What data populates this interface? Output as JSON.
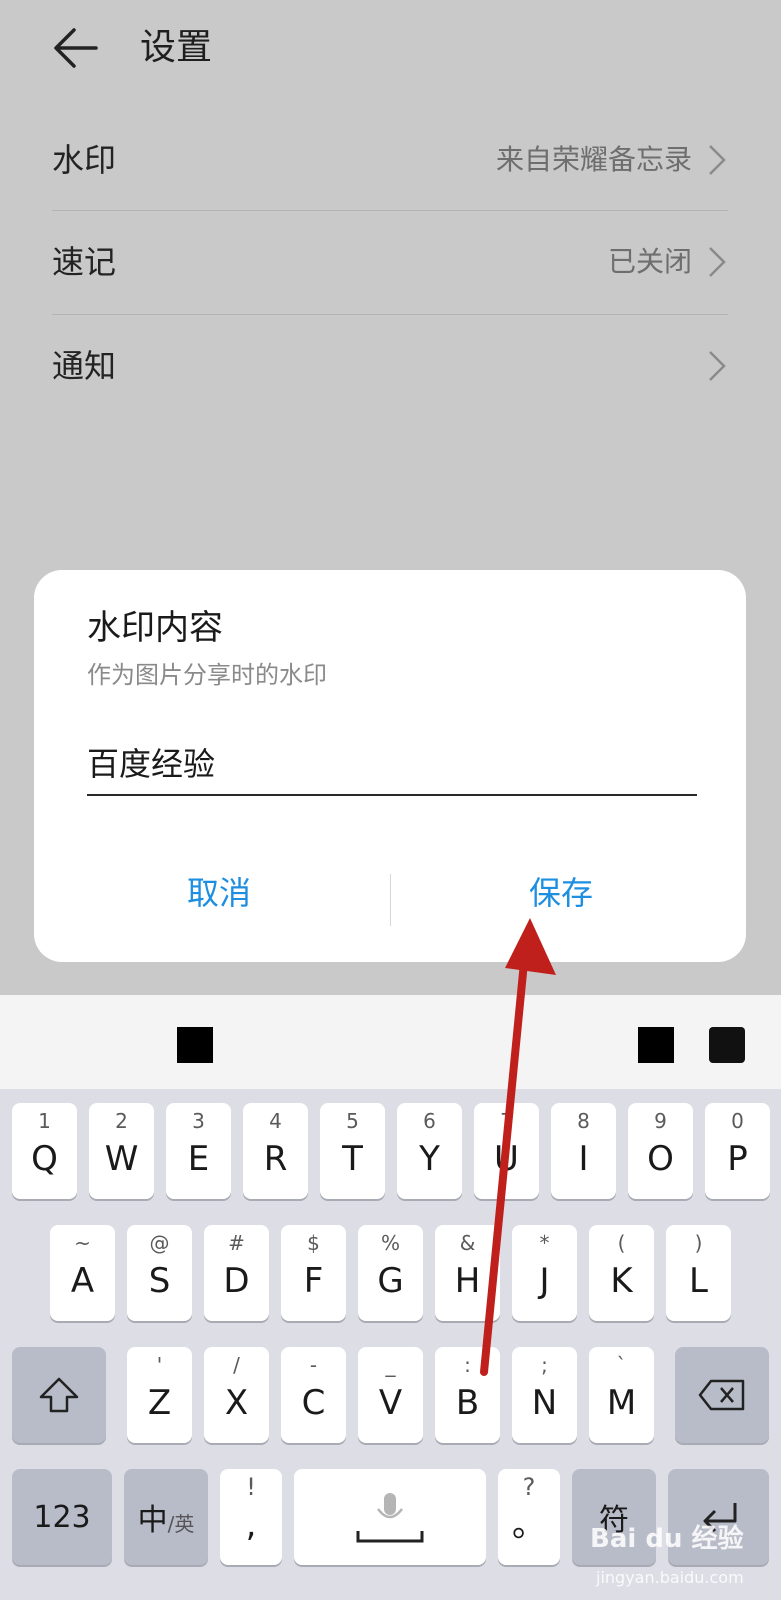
{
  "header": {
    "title": "设置"
  },
  "settings": [
    {
      "label": "水印",
      "value": "来自荣耀备忘录"
    },
    {
      "label": "速记",
      "value": "已关闭"
    },
    {
      "label": "通知",
      "value": ""
    }
  ],
  "dialog": {
    "title": "水印内容",
    "subtitle": "作为图片分享时的水印",
    "input_value": "百度经验",
    "cancel_label": "取消",
    "save_label": "保存"
  },
  "keyboard": {
    "row1": [
      {
        "hint": "1",
        "key": "Q"
      },
      {
        "hint": "2",
        "key": "W"
      },
      {
        "hint": "3",
        "key": "E"
      },
      {
        "hint": "4",
        "key": "R"
      },
      {
        "hint": "5",
        "key": "T"
      },
      {
        "hint": "6",
        "key": "Y"
      },
      {
        "hint": "7",
        "key": "U"
      },
      {
        "hint": "8",
        "key": "I"
      },
      {
        "hint": "9",
        "key": "O"
      },
      {
        "hint": "0",
        "key": "P"
      }
    ],
    "row2": [
      {
        "hint": "~",
        "key": "A"
      },
      {
        "hint": "@",
        "key": "S"
      },
      {
        "hint": "#",
        "key": "D"
      },
      {
        "hint": "$",
        "key": "F"
      },
      {
        "hint": "%",
        "key": "G"
      },
      {
        "hint": "&",
        "key": "H"
      },
      {
        "hint": "*",
        "key": "J"
      },
      {
        "hint": "(",
        "key": "K"
      },
      {
        "hint": ")",
        "key": "L"
      }
    ],
    "row3": [
      {
        "hint": "'",
        "key": "Z"
      },
      {
        "hint": "/",
        "key": "X"
      },
      {
        "hint": "-",
        "key": "C"
      },
      {
        "hint": "_",
        "key": "V"
      },
      {
        "hint": ":",
        "key": "B"
      },
      {
        "hint": ";",
        "key": "N"
      },
      {
        "hint": "`",
        "key": "M"
      }
    ],
    "num_label": "123",
    "lang_label_main": "中",
    "lang_label_sub": "/英",
    "punct_hint": "!",
    "punct_key": ",",
    "period_hint": "?",
    "period_key": "。",
    "symbol_label": "符"
  },
  "watermark": {
    "brand": "Bai du 经验",
    "url": "jingyan.baidu.com"
  },
  "colors": {
    "accent": "#1e8fe0",
    "arrow": "#c0201c"
  }
}
